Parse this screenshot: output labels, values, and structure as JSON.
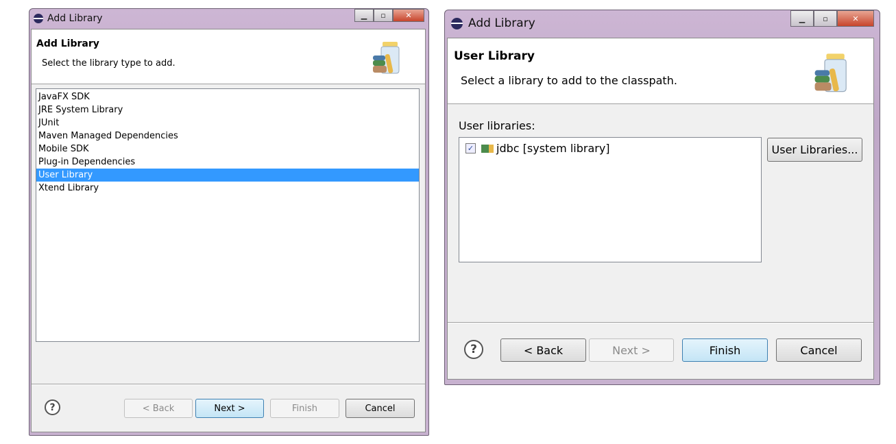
{
  "left_dialog": {
    "window_title": "Add Library",
    "header_title": "Add Library",
    "header_subtitle": "Select the library type to add.",
    "library_types": [
      "JavaFX SDK",
      "JRE System Library",
      "JUnit",
      "Maven Managed Dependencies",
      "Mobile SDK",
      "Plug-in Dependencies",
      "User Library",
      "Xtend Library"
    ],
    "selected": "User Library",
    "buttons": {
      "back": "< Back",
      "next": "Next >",
      "finish": "Finish",
      "cancel": "Cancel"
    },
    "help": "?"
  },
  "right_dialog": {
    "window_title": "Add Library",
    "header_title": "User Library",
    "header_subtitle": "Select a library to add to the classpath.",
    "list_label": "User libraries:",
    "libraries": [
      {
        "label": "jdbc [system library]",
        "checked": true
      }
    ],
    "user_libraries_button": "User Libraries...",
    "buttons": {
      "back": "< Back",
      "next": "Next >",
      "finish": "Finish",
      "cancel": "Cancel"
    },
    "help": "?"
  },
  "colors": {
    "selection": "#3399ff",
    "default_button": "#c4e5f6"
  }
}
